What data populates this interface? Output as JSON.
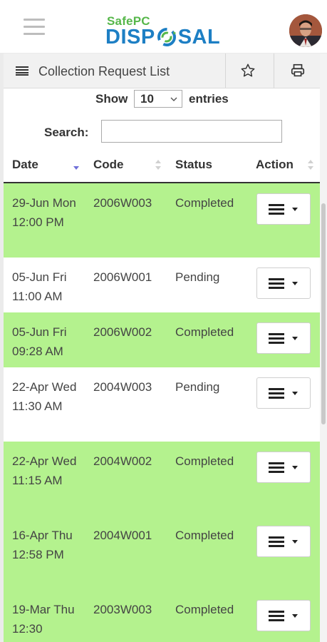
{
  "header": {
    "logo_top": "SafePC",
    "logo_left": "DISP",
    "logo_right": "SAL"
  },
  "panel": {
    "title": "Collection Request List"
  },
  "controls": {
    "show_label": "Show",
    "entries_value": "10",
    "entries_label": "entries",
    "search_label": "Search:",
    "search_value": ""
  },
  "table": {
    "columns": [
      "Date",
      "Code",
      "Status",
      "Action"
    ],
    "rows": [
      {
        "date": "29-Jun Mon 12:00 PM",
        "code": "2006W003",
        "status": "Completed"
      },
      {
        "date": "05-Jun Fri 11:00 AM",
        "code": "2006W001",
        "status": "Pending"
      },
      {
        "date": "05-Jun Fri 09:28 AM",
        "code": "2006W002",
        "status": "Completed"
      },
      {
        "date": "22-Apr Wed 11:30 AM",
        "code": "2004W003",
        "status": "Pending"
      },
      {
        "date": "22-Apr Wed 11:15 AM",
        "code": "2004W002",
        "status": "Completed"
      },
      {
        "date": "16-Apr Thu 12:58 PM",
        "code": "2004W001",
        "status": "Completed"
      },
      {
        "date": "19-Mar Thu 12:30",
        "code": "2003W003",
        "status": "Completed"
      }
    ]
  },
  "colors": {
    "completed_row": "#b4f28e",
    "pending_row": "#ffffff",
    "logo_green": "#56b74a",
    "logo_blue": "#1d7fc4",
    "sort_active": "#6f6fd8"
  },
  "icons": {
    "menu": "hamburger-menu-icon",
    "list": "list-icon",
    "favorite": "star-outline-icon",
    "print": "printer-icon",
    "action": "menu-bars-icon",
    "dropdown": "caret-down-icon"
  }
}
